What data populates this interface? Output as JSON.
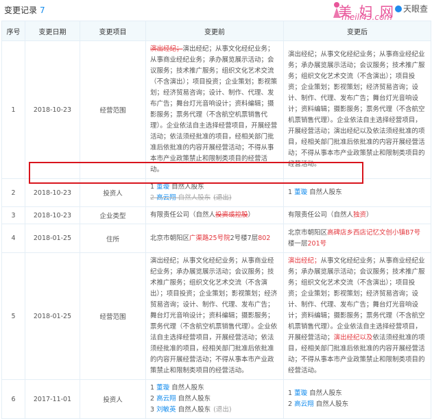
{
  "section": {
    "title": "变更记录",
    "count": "7"
  },
  "watermark": {
    "logo": "美 妇 网",
    "url": "meili43.com",
    "tyc": "天眼查"
  },
  "columns": [
    "序号",
    "变更日期",
    "变更项目",
    "变更前",
    "变更后"
  ],
  "rows": [
    {
      "no": "1",
      "date": "2018-10-23",
      "item": "经营范围",
      "before_strike": "演出经纪；",
      "before": "演出经纪；从事文化经纪业务；从事商业经纪业务；承办展览展示活动；会议服务；技术推广服务；组织文化艺术交流（不含演出）；项目投资；企业策划；影视策划；经济贸易咨询；设计、制作、代理、发布广告；舞台灯光音响设计；资料编辑；摄影服务；票务代理（不含航空机票销售代理）。企业依法自主选择经营项目，开展经营活动；依法须经批准的项目，经相关部门批准后依批准的内容开展经营活动；不得从事本市产业政策禁止和限制类项目的经营活动。",
      "after": "演出经纪；从事文化经纪业务；从事商业经纪业务；承办展览展示活动；会议服务；技术推广服务；组织文化艺术交流（不含演出）；项目投资；企业策划；影视策划；经济贸易咨询；设计、制作、代理、发布广告；舞台灯光音响设计；资料编辑；摄影服务；票务代理（不含航空机票销售代理）。企业依法自主选择经营项目，开展经营活动；演出经纪以及依法须经批准的项目，经相关部门批准后依批准的内容开展经营活动；不得从事本市产业政策禁止和限制类项目的经营活动。"
    },
    {
      "no": "2",
      "date": "2018-10-23",
      "item": "投资人",
      "before_investors": [
        {
          "num": "1",
          "name": "董璇",
          "role": "自然人股东",
          "exit": ""
        },
        {
          "num": "2",
          "name": "高云翔",
          "role": "自然人股东",
          "exit": "(退出)"
        }
      ],
      "after_investors": [
        {
          "num": "1",
          "name": "董璇",
          "role": "自然人股东"
        }
      ]
    },
    {
      "no": "3",
      "date": "2018-10-23",
      "item": "企业类型",
      "before_pre": "有限责任公司（自然人",
      "before_red": "投资或控股",
      "before_post": "）",
      "after_pre": "有限责任公司（自然人",
      "after_red": "独资",
      "after_post": "）"
    },
    {
      "no": "4",
      "date": "2018-01-25",
      "item": "住所",
      "before_pre": "北京市朝阳区",
      "before_red1": "广渠路25号院",
      "before_mid": "2号楼7层",
      "before_red2": "802",
      "after_pre": "北京市朝阳区",
      "after_red1": "高碑店乡西店记忆文创小镇B7号",
      "after_mid": "楼一层",
      "after_red2": "201号"
    },
    {
      "no": "5",
      "date": "2018-01-25",
      "item": "经营范围",
      "before": "演出经纪；从事文化经纪业务；从事商业经纪业务；承办展览展示活动；会议服务；技术推广服务；组织文化艺术交流（不含演出）；项目投资；企业策划；影视策划；经济贸易咨询；设计、制作、代理、发布广告；舞台灯光音响设计；资料编辑；摄影服务；票务代理（不含航空机票销售代理）。企业依法自主选择经营项目，开展经营活动；依法须经批准的项目，经相关部门批准后依批准的内容开展经营活动；不得从事本市产业政策禁止和限制类项目的经营活动。",
      "after_red1": "演出经纪；",
      "after_mid1": "从事文化经纪业务；从事商业经纪业务；承办展览展示活动；会议服务；技术推广服务；组织文化艺术交流（不含演出）；项目投资；企业策划；影视策划；经济贸易咨询；设计、制作、代理、发布广告；舞台灯光音响设计；资料编辑；摄影服务；票务代理（不含航空机票销售代理）。企业依法自主选择经营项目，开展经营活动；",
      "after_red2": "演出经纪以及",
      "after_mid2": "依法须经批准的项目，经相关部门批准后依批准的内容开展经营活动；不得从事本市产业政策禁止和限制类项目的经营活动。"
    },
    {
      "no": "6",
      "date": "2017-11-01",
      "item": "投资人",
      "before_investors": [
        {
          "num": "1",
          "name": "董璇",
          "role": "自然人股东",
          "exit": ""
        },
        {
          "num": "2",
          "name": "高云翔",
          "role": "自然人股东",
          "exit": ""
        },
        {
          "num": "3",
          "name": "刘敏英",
          "role": "自然人股东",
          "exit": "(退出)"
        }
      ],
      "after_investors": [
        {
          "num": "1",
          "name": "董璇",
          "role": "自然人股东"
        },
        {
          "num": "2",
          "name": "高云翔",
          "role": "自然人股东"
        }
      ]
    }
  ],
  "colors": {
    "accent": "#128bed",
    "changed": "#e3363c",
    "highlight_box": "#d8141c",
    "header_bg": "#f2f9fc"
  }
}
